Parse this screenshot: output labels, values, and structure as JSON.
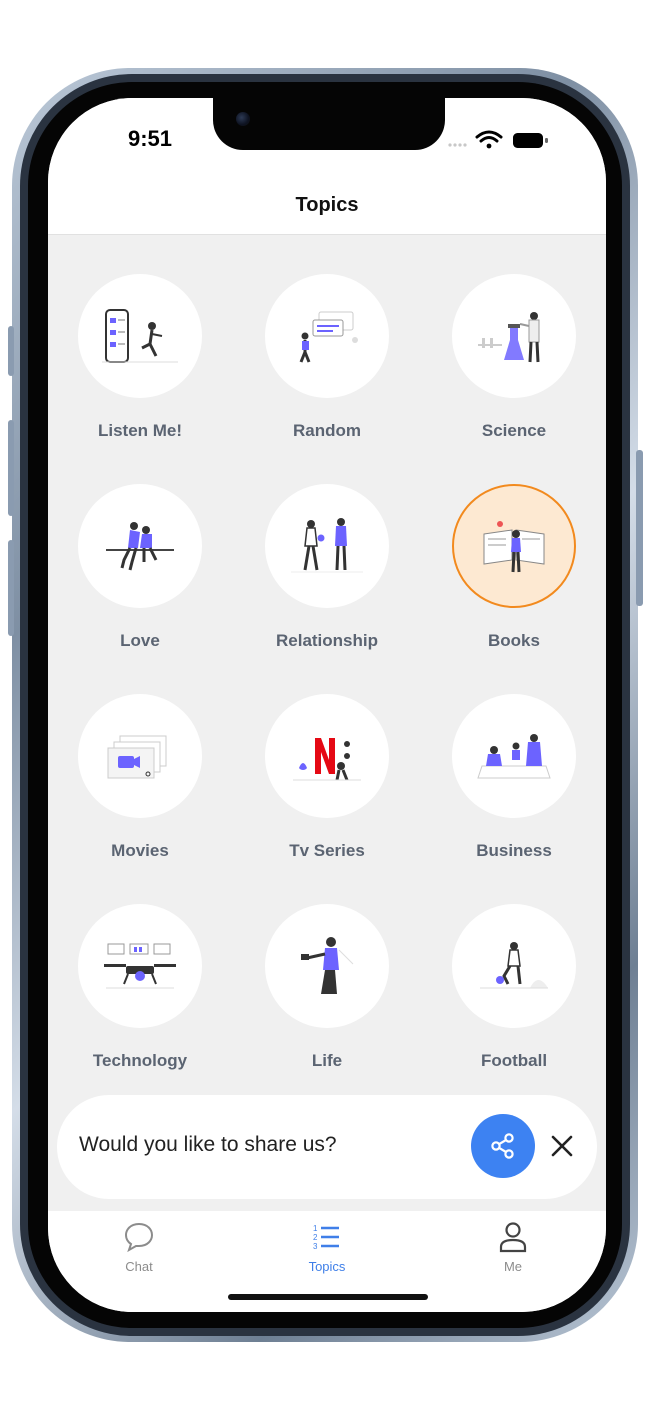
{
  "status": {
    "time": "9:51"
  },
  "nav": {
    "title": "Topics"
  },
  "topics": [
    {
      "label": "Listen Me!",
      "icon": "phone-list-illustration-icon"
    },
    {
      "label": "Random",
      "icon": "chat-bubbles-illustration-icon"
    },
    {
      "label": "Science",
      "icon": "lab-scientist-illustration-icon"
    },
    {
      "label": "Love",
      "icon": "couple-sitting-illustration-icon"
    },
    {
      "label": "Relationship",
      "icon": "two-people-illustration-icon"
    },
    {
      "label": "Books",
      "icon": "open-book-illustration-icon",
      "selected": true
    },
    {
      "label": "Movies",
      "icon": "video-camera-illustration-icon"
    },
    {
      "label": "Tv Series",
      "icon": "netflix-logo-illustration-icon"
    },
    {
      "label": "Business",
      "icon": "meeting-table-illustration-icon"
    },
    {
      "label": "Technology",
      "icon": "drone-dashboard-illustration-icon"
    },
    {
      "label": "Life",
      "icon": "person-juggling-illustration-icon"
    },
    {
      "label": "Football",
      "icon": "football-player-illustration-icon"
    }
  ],
  "share": {
    "text": "Would you like to share us?"
  },
  "tabs": [
    {
      "label": "Chat",
      "icon": "chat-bubble-icon"
    },
    {
      "label": "Topics",
      "icon": "numbered-list-icon",
      "active": true
    },
    {
      "label": "Me",
      "icon": "person-icon"
    }
  ],
  "colors": {
    "accent": "#3d82f2",
    "selected_border": "#f28a1e",
    "illustration_purple": "#6c63ff",
    "background": "#f0f0f0"
  }
}
